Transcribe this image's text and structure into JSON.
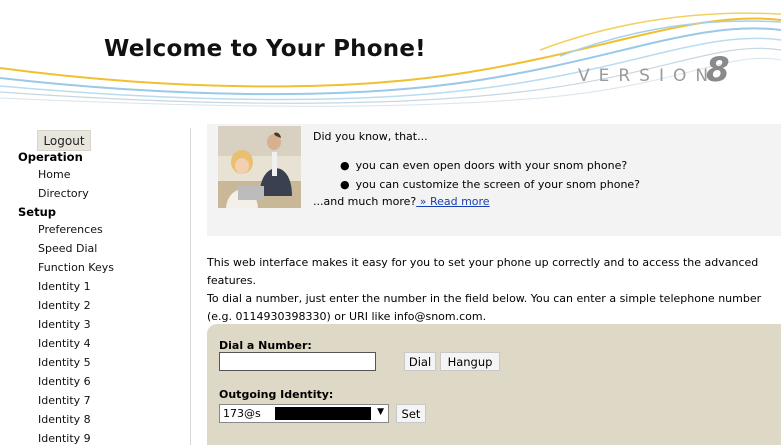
{
  "header": {
    "title": "Welcome to Your Phone!",
    "version_label": "VERSION",
    "version_number": "8"
  },
  "sidebar": {
    "logout": "Logout",
    "operation_heading": "Operation",
    "operation_items": [
      "Home",
      "Directory"
    ],
    "setup_heading": "Setup",
    "setup_items": [
      "Preferences",
      "Speed Dial",
      "Function Keys",
      "Identity 1",
      "Identity 2",
      "Identity 3",
      "Identity 4",
      "Identity 5",
      "Identity 6",
      "Identity 7",
      "Identity 8",
      "Identity 9"
    ]
  },
  "tip": {
    "title": "Did you know, that...",
    "bullets": [
      "you can even open doors with your snom phone?",
      "you can customize the screen of your snom phone?"
    ],
    "more_prefix": "...and much more?",
    "read_more": " » Read more"
  },
  "intro": {
    "p1": "This web interface makes it easy for you to set your phone up correctly and to access the advanced features.",
    "p2": "To dial a number, just enter the number in the field below. You can enter a simple telephone number (e.g. 0114930398330) or URI like info@snom.com."
  },
  "dial": {
    "label": "Dial a Number:",
    "input_value": "",
    "dial_button": "Dial",
    "hangup_button": "Hangup",
    "identity_label": "Outgoing Identity:",
    "identity_value": "173@s",
    "set_button": "Set"
  }
}
